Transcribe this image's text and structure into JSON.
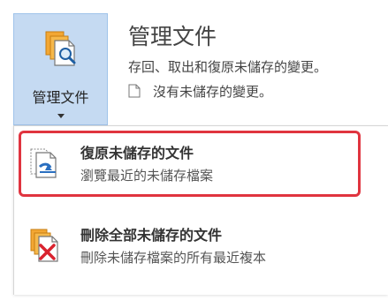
{
  "manage_button": {
    "label": "管理文件",
    "icon": "manage-document-icon"
  },
  "info": {
    "title": "管理文件",
    "description": "存回、取出和復原未儲存的變更。",
    "status": "沒有未儲存的變更。",
    "status_icon": "document-icon"
  },
  "dropdown": {
    "items": [
      {
        "title": "復原未儲存的文件",
        "description": "瀏覽最近的未儲存檔案",
        "icon": "recover-document-icon",
        "highlight_color": "#e0343f"
      },
      {
        "title": "刪除全部未儲存的文件",
        "description": "刪除未儲存檔案的所有最近複本",
        "icon": "delete-documents-icon"
      }
    ]
  }
}
